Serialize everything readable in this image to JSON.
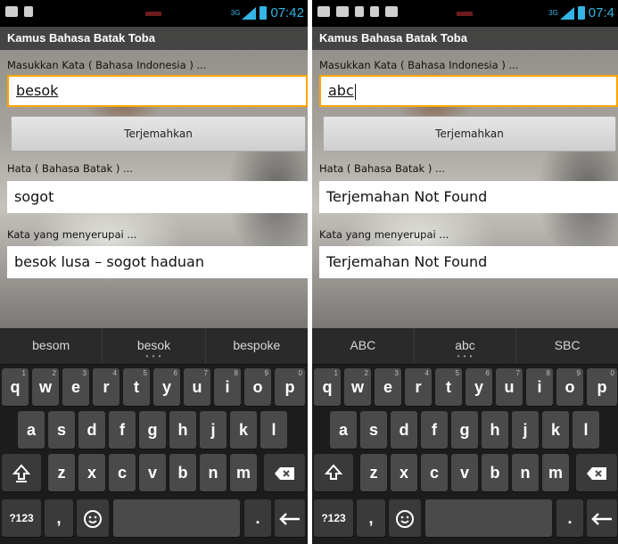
{
  "screens": [
    {
      "status": {
        "network": "3G",
        "time": "07:42"
      },
      "app_title": "Kamus Bahasa Batak Toba",
      "input_label": "Masukkan Kata ( Bahasa Indonesia ) ...",
      "input_value": "besok",
      "translate_button": "Terjemahkan",
      "result_label": "Hata ( Bahasa Batak ) ...",
      "result_value": "sogot",
      "similar_label": "Kata yang menyerupai ...",
      "similar_value": "besok lusa – sogot haduan",
      "suggestions": [
        "besom",
        "besok",
        "bespoke"
      ]
    },
    {
      "status": {
        "network": "3G",
        "time": "07:4"
      },
      "app_title": "Kamus Bahasa Batak Toba",
      "input_label": "Masukkan Kata ( Bahasa Indonesia ) ...",
      "input_value": "abc",
      "translate_button": "Terjemahkan",
      "result_label": "Hata ( Bahasa Batak ) ...",
      "result_value": "Terjemahan Not Found",
      "similar_label": "Kata yang menyerupai ...",
      "similar_value": "Terjemahan Not Found",
      "suggestions": [
        "ABC",
        "abc",
        "SBC"
      ]
    }
  ],
  "keyboard": {
    "row1": [
      {
        "k": "q",
        "h": "1"
      },
      {
        "k": "w",
        "h": "2"
      },
      {
        "k": "e",
        "h": "3"
      },
      {
        "k": "r",
        "h": "4"
      },
      {
        "k": "t",
        "h": "5"
      },
      {
        "k": "y",
        "h": "6"
      },
      {
        "k": "u",
        "h": "7"
      },
      {
        "k": "i",
        "h": "8"
      },
      {
        "k": "o",
        "h": "9"
      },
      {
        "k": "p",
        "h": "0"
      }
    ],
    "row2": [
      "a",
      "s",
      "d",
      "f",
      "g",
      "h",
      "j",
      "k",
      "l"
    ],
    "row3": [
      "z",
      "x",
      "c",
      "v",
      "b",
      "n",
      "m"
    ],
    "symbols_key": "?123",
    "comma_key": ",",
    "period_key": ".",
    "icons": {
      "shift": "shift-icon",
      "backspace": "backspace-icon",
      "emoji": "emoji-icon",
      "enter": "enter-icon"
    }
  },
  "colors": {
    "accent": "#33b5e5",
    "input_border": "#ffa500",
    "keyboard_bg": "#1c1c1c",
    "key_bg": "#4a4a4a"
  }
}
